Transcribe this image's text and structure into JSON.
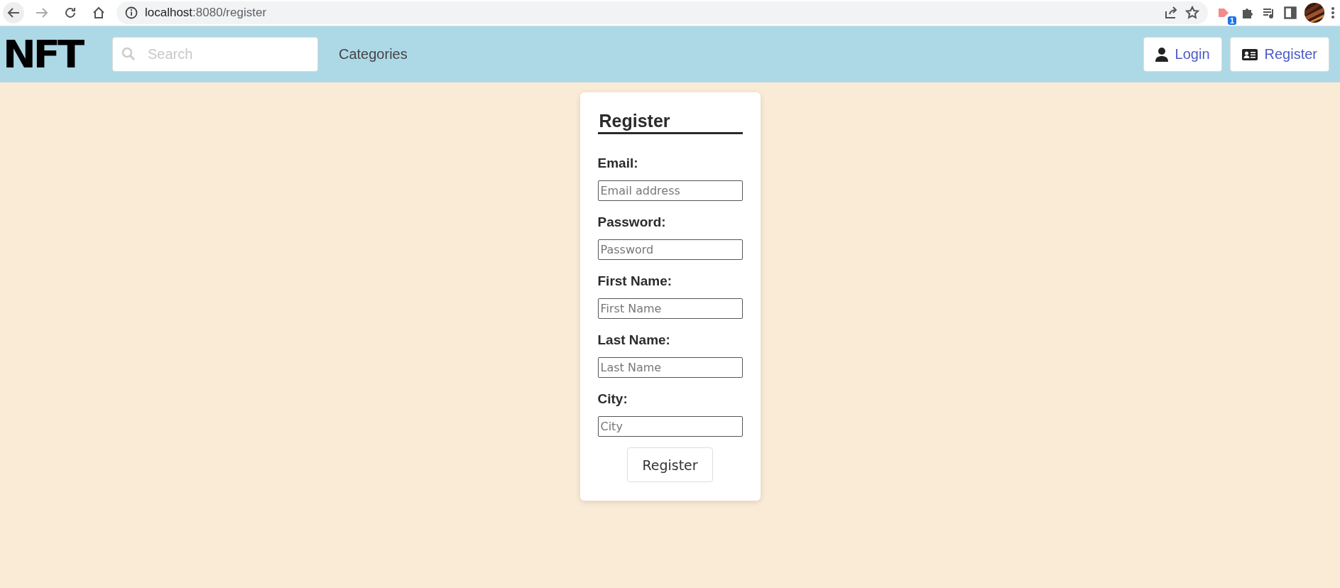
{
  "browser": {
    "url_host": "localhost",
    "url_path": ":8080/register",
    "extension_badge": "1"
  },
  "navbar": {
    "logo": "NFT",
    "search": {
      "placeholder": "Search"
    },
    "links": [
      "Categories"
    ],
    "buttons": [
      {
        "label": "Login",
        "kind": "user"
      },
      {
        "label": "Register",
        "kind": "card"
      }
    ]
  },
  "form": {
    "title": "Register",
    "fields": [
      {
        "label": "Email:",
        "placeholder": "Email address"
      },
      {
        "label": "Password:",
        "placeholder": "Password"
      },
      {
        "label": "First Name:",
        "placeholder": "First Name"
      },
      {
        "label": "Last Name:",
        "placeholder": "Last Name"
      },
      {
        "label": "City:",
        "placeholder": "City"
      }
    ],
    "submit": "Register"
  }
}
